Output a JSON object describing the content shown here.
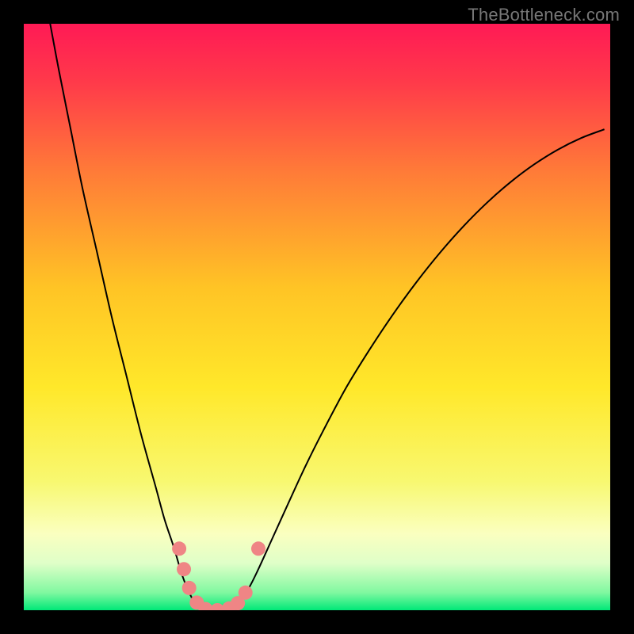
{
  "watermark": "TheBottleneck.com",
  "chart_data": {
    "type": "line",
    "title": "",
    "xlabel": "",
    "ylabel": "",
    "xlim": [
      0,
      100
    ],
    "ylim": [
      0,
      100
    ],
    "grid": false,
    "legend": false,
    "background_gradient": {
      "top_color": "#ff1a50",
      "mid_color": "#ffeb2a",
      "bottom_color": "#00e878",
      "stops": [
        {
          "offset": 0.0,
          "color": "#ff1a55"
        },
        {
          "offset": 0.1,
          "color": "#ff3a4a"
        },
        {
          "offset": 0.25,
          "color": "#ff7a38"
        },
        {
          "offset": 0.45,
          "color": "#ffc425"
        },
        {
          "offset": 0.62,
          "color": "#ffe82a"
        },
        {
          "offset": 0.78,
          "color": "#f8f870"
        },
        {
          "offset": 0.87,
          "color": "#faffc0"
        },
        {
          "offset": 0.92,
          "color": "#dfffc8"
        },
        {
          "offset": 0.97,
          "color": "#80f8a0"
        },
        {
          "offset": 1.0,
          "color": "#00e878"
        }
      ]
    },
    "series": [
      {
        "name": "curve",
        "stroke": "#000000",
        "stroke_width": 2,
        "points": [
          {
            "x": 4.5,
            "y": 100.0
          },
          {
            "x": 6.0,
            "y": 92.0
          },
          {
            "x": 8.0,
            "y": 82.0
          },
          {
            "x": 10.0,
            "y": 72.0
          },
          {
            "x": 12.5,
            "y": 61.0
          },
          {
            "x": 15.0,
            "y": 50.0
          },
          {
            "x": 17.5,
            "y": 40.0
          },
          {
            "x": 20.0,
            "y": 30.0
          },
          {
            "x": 22.5,
            "y": 21.0
          },
          {
            "x": 24.0,
            "y": 15.5
          },
          {
            "x": 25.5,
            "y": 11.0
          },
          {
            "x": 27.0,
            "y": 6.0
          },
          {
            "x": 28.0,
            "y": 3.5
          },
          {
            "x": 29.0,
            "y": 1.5
          },
          {
            "x": 30.0,
            "y": 0.5
          },
          {
            "x": 31.0,
            "y": 0.0
          },
          {
            "x": 32.5,
            "y": 0.0
          },
          {
            "x": 34.0,
            "y": 0.0
          },
          {
            "x": 35.5,
            "y": 0.5
          },
          {
            "x": 37.0,
            "y": 1.8
          },
          {
            "x": 38.5,
            "y": 4.0
          },
          {
            "x": 40.0,
            "y": 7.0
          },
          {
            "x": 42.5,
            "y": 12.5
          },
          {
            "x": 45.0,
            "y": 18.0
          },
          {
            "x": 48.0,
            "y": 24.5
          },
          {
            "x": 51.0,
            "y": 30.5
          },
          {
            "x": 55.0,
            "y": 38.0
          },
          {
            "x": 59.0,
            "y": 44.5
          },
          {
            "x": 63.0,
            "y": 50.5
          },
          {
            "x": 67.0,
            "y": 56.0
          },
          {
            "x": 71.0,
            "y": 61.0
          },
          {
            "x": 75.0,
            "y": 65.5
          },
          {
            "x": 79.0,
            "y": 69.5
          },
          {
            "x": 83.0,
            "y": 73.0
          },
          {
            "x": 87.0,
            "y": 76.0
          },
          {
            "x": 91.0,
            "y": 78.5
          },
          {
            "x": 95.0,
            "y": 80.5
          },
          {
            "x": 99.0,
            "y": 82.0
          }
        ]
      }
    ],
    "markers": {
      "color": "#ef8585",
      "radius": 9,
      "points": [
        {
          "x": 26.5,
          "y": 10.5
        },
        {
          "x": 27.3,
          "y": 7.0
        },
        {
          "x": 28.2,
          "y": 3.8
        },
        {
          "x": 29.5,
          "y": 1.3
        },
        {
          "x": 31.0,
          "y": 0.2
        },
        {
          "x": 33.0,
          "y": 0.0
        },
        {
          "x": 35.0,
          "y": 0.3
        },
        {
          "x": 36.5,
          "y": 1.2
        },
        {
          "x": 37.8,
          "y": 3.0
        },
        {
          "x": 40.0,
          "y": 10.5
        }
      ]
    }
  }
}
